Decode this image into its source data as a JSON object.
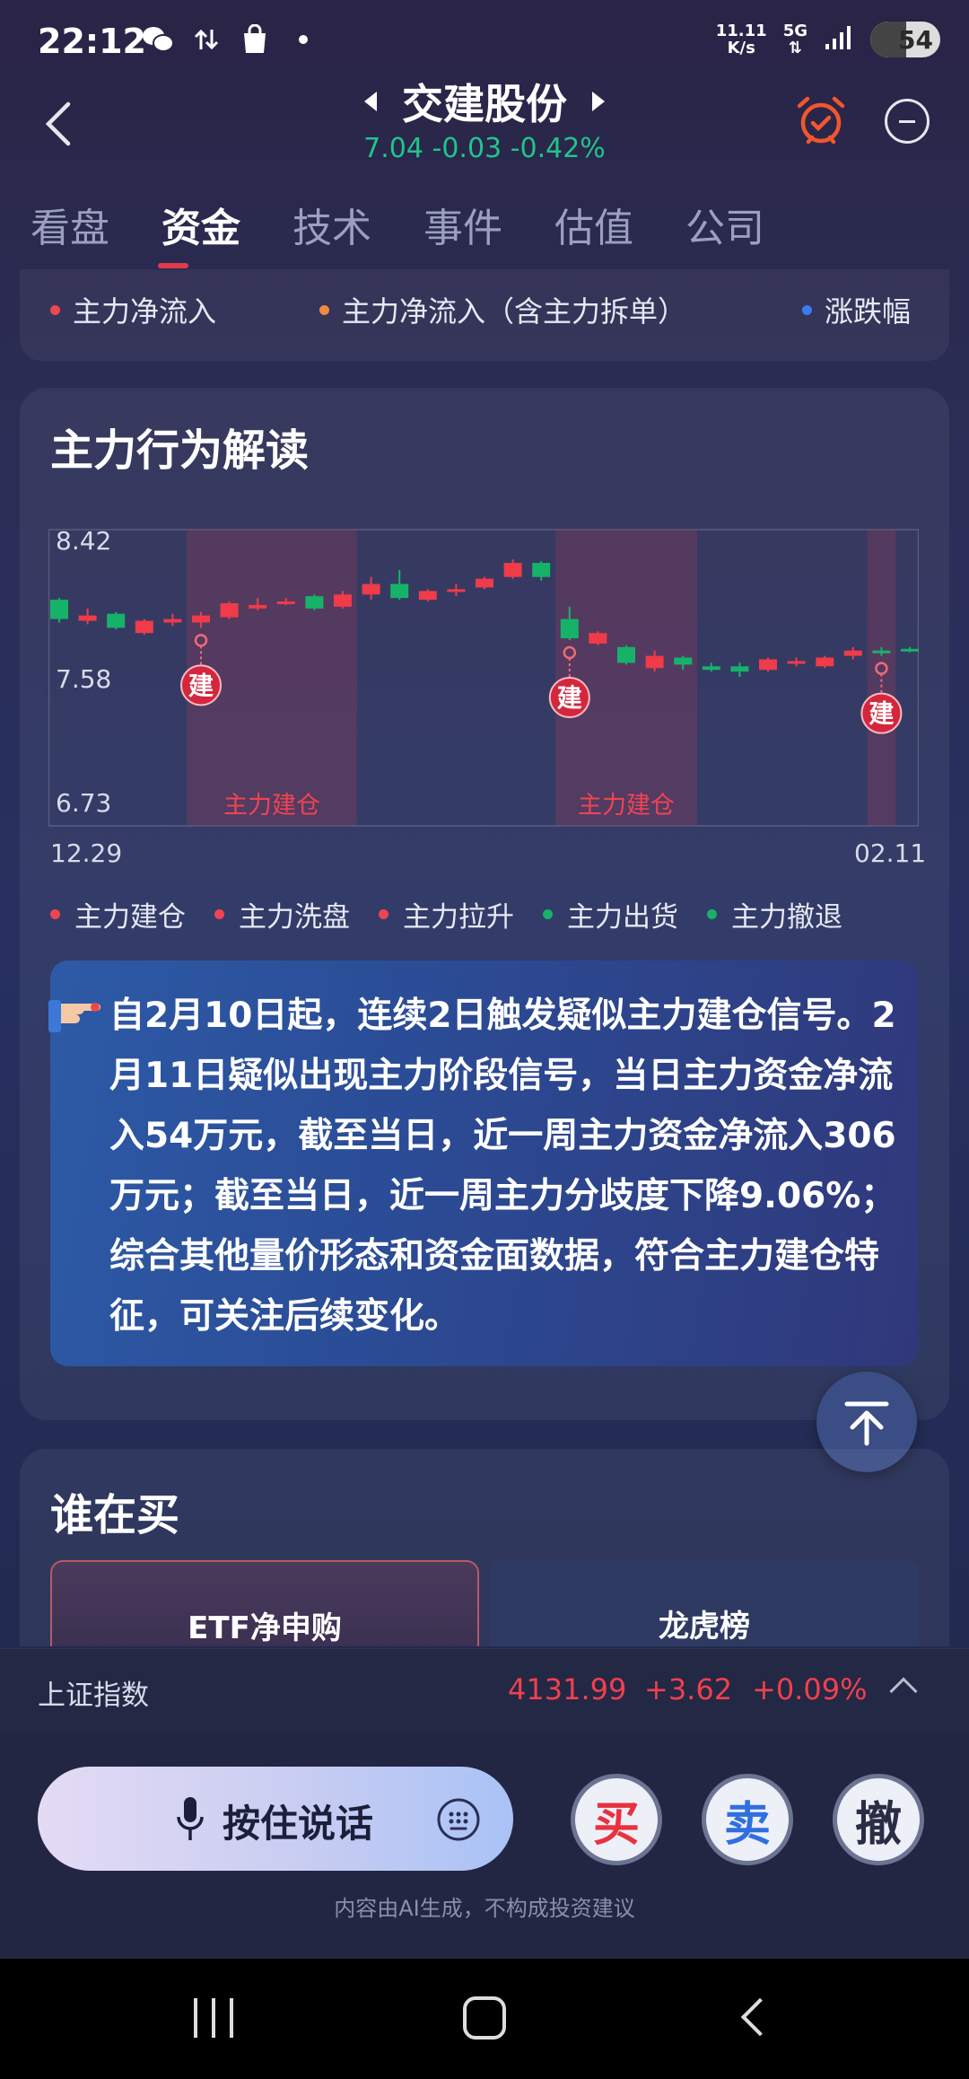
{
  "status_bar": {
    "time": "22:12",
    "net_speed_value": "11.11",
    "net_speed_unit": "K/s",
    "network": "5G",
    "battery": "54",
    "icons": [
      "wechat-icon",
      "data-transfer-icon",
      "shopping-bag-icon",
      "notification-dot-icon",
      "signal-icon"
    ]
  },
  "header": {
    "title": "交建股份",
    "price": "7.04",
    "change": "-0.03",
    "change_pct": "-0.42%",
    "quote_color": "#21c48a"
  },
  "tabs": [
    "看盘",
    "资金",
    "技术",
    "事件",
    "估值",
    "公司"
  ],
  "active_tab": "资金",
  "flow_legend": [
    {
      "label": "主力净流入",
      "color": "#ef4452"
    },
    {
      "label": "主力净流入（含主力拆单）",
      "color": "#f08a3c"
    },
    {
      "label": "涨跌幅",
      "color": "#3b7bf0"
    }
  ],
  "behavior_card": {
    "title": "主力行为解读",
    "y_labels": [
      "8.42",
      "7.58",
      "6.73"
    ],
    "x_labels": [
      "12.29",
      "02.11"
    ],
    "zone_labels": [
      "主力建仓",
      "主力建仓"
    ],
    "marker_label": "建",
    "legend": [
      {
        "label": "主力建仓",
        "color": "#ef4452"
      },
      {
        "label": "主力洗盘",
        "color": "#ef4452"
      },
      {
        "label": "主力拉升",
        "color": "#ef4452"
      },
      {
        "label": "主力出货",
        "color": "#17b26a"
      },
      {
        "label": "主力撤退",
        "color": "#17b26a"
      }
    ],
    "analysis_text": "自2月10日起，连续2日触发疑似主力建仓信号。2月11日疑似出现主力阶段信号，当日主力资金净流入54万元，截至当日，近一周主力资金净流入306万元；截至当日，近一周主力分歧度下降9.06%；综合其他量价形态和资金面数据，符合主力建仓特征，可关注后续变化。"
  },
  "chart_data": {
    "type": "candlestick",
    "x_range": [
      "12.29",
      "02.11"
    ],
    "y_range": [
      6.73,
      8.42
    ],
    "y_ticks": [
      8.42,
      7.58,
      6.73
    ],
    "up_color": "#ef3b4a",
    "down_color": "#17b26a",
    "candles": [
      {
        "o": 8.02,
        "c": 7.91,
        "h": 8.03,
        "l": 7.89
      },
      {
        "o": 7.9,
        "c": 7.93,
        "h": 7.97,
        "l": 7.88
      },
      {
        "o": 7.94,
        "c": 7.86,
        "h": 7.95,
        "l": 7.85
      },
      {
        "o": 7.83,
        "c": 7.9,
        "h": 7.91,
        "l": 7.82
      },
      {
        "o": 7.89,
        "c": 7.91,
        "h": 7.94,
        "l": 7.87
      },
      {
        "o": 7.89,
        "c": 7.93,
        "h": 7.95,
        "l": 7.86
      },
      {
        "o": 7.92,
        "c": 8.0,
        "h": 8.01,
        "l": 7.91
      },
      {
        "o": 7.97,
        "c": 7.99,
        "h": 8.03,
        "l": 7.96
      },
      {
        "o": 8.0,
        "c": 8.01,
        "h": 8.03,
        "l": 7.99
      },
      {
        "o": 8.04,
        "c": 7.97,
        "h": 8.05,
        "l": 7.96
      },
      {
        "o": 7.98,
        "c": 8.05,
        "h": 8.07,
        "l": 7.97
      },
      {
        "o": 8.05,
        "c": 8.11,
        "h": 8.15,
        "l": 8.02
      },
      {
        "o": 8.11,
        "c": 8.03,
        "h": 8.19,
        "l": 8.02
      },
      {
        "o": 8.02,
        "c": 8.07,
        "h": 8.08,
        "l": 8.01
      },
      {
        "o": 8.07,
        "c": 8.08,
        "h": 8.11,
        "l": 8.04
      },
      {
        "o": 8.09,
        "c": 8.14,
        "h": 8.15,
        "l": 8.08
      },
      {
        "o": 8.15,
        "c": 8.23,
        "h": 8.25,
        "l": 8.14
      },
      {
        "o": 8.23,
        "c": 8.15,
        "h": 8.24,
        "l": 8.13
      },
      {
        "o": 7.91,
        "c": 7.8,
        "h": 7.98,
        "l": 7.79
      },
      {
        "o": 7.77,
        "c": 7.83,
        "h": 7.84,
        "l": 7.76
      },
      {
        "o": 7.75,
        "c": 7.66,
        "h": 7.76,
        "l": 7.65
      },
      {
        "o": 7.63,
        "c": 7.7,
        "h": 7.73,
        "l": 7.61
      },
      {
        "o": 7.69,
        "c": 7.65,
        "h": 7.7,
        "l": 7.62
      },
      {
        "o": 7.64,
        "c": 7.62,
        "h": 7.66,
        "l": 7.61
      },
      {
        "o": 7.64,
        "c": 7.61,
        "h": 7.66,
        "l": 7.58
      },
      {
        "o": 7.62,
        "c": 7.68,
        "h": 7.69,
        "l": 7.61
      },
      {
        "o": 7.66,
        "c": 7.67,
        "h": 7.69,
        "l": 7.64
      },
      {
        "o": 7.64,
        "c": 7.69,
        "h": 7.7,
        "l": 7.63
      },
      {
        "o": 7.7,
        "c": 7.73,
        "h": 7.75,
        "l": 7.68
      },
      {
        "o": 7.73,
        "c": 7.72,
        "h": 7.75,
        "l": 7.7
      },
      {
        "o": 7.74,
        "c": 7.73,
        "h": 7.75,
        "l": 7.72
      }
    ],
    "zones": [
      {
        "label": "主力建仓",
        "from_index": 5,
        "to_index": 10
      },
      {
        "label": "主力建仓",
        "from_index": 18,
        "to_index": 22
      },
      {
        "from_index": 29,
        "to_index": 29
      }
    ],
    "markers": [
      {
        "label": "建",
        "index": 5
      },
      {
        "label": "建",
        "index": 18
      },
      {
        "label": "建",
        "index": 29
      }
    ]
  },
  "buy_section": {
    "title": "谁在买",
    "tabs": [
      "ETF净申购",
      "龙虎榜"
    ]
  },
  "index_bar": {
    "name": "上证指数",
    "value": "4131.99",
    "change": "+3.62",
    "change_pct": "+0.09%",
    "color": "#f0404e"
  },
  "controls": {
    "voice_label": "按住说话",
    "buy_label": "买",
    "sell_label": "卖",
    "cancel_label": "撤",
    "disclaimer": "内容由AI生成，不构成投资建议"
  }
}
